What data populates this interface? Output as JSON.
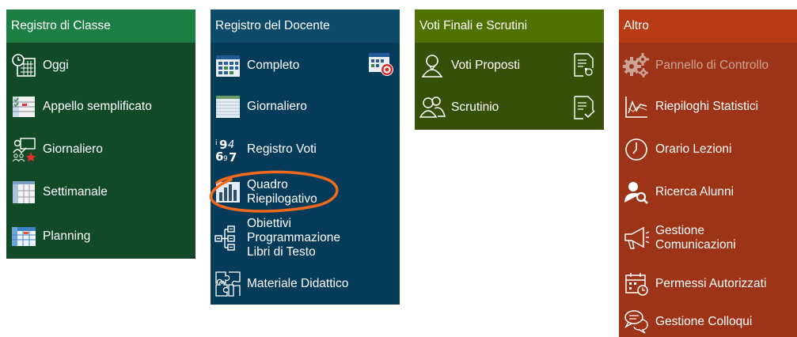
{
  "panels": {
    "registro_classe": {
      "title": "Registro di Classe",
      "items": [
        "Oggi",
        "Appello semplificato",
        "Giornaliero",
        "Settimanale",
        "Planning"
      ]
    },
    "registro_docente": {
      "title": "Registro del Docente",
      "items": [
        "Completo",
        "Giornaliero",
        "Registro Voti",
        "Quadro\nRiepilogativo",
        "Obiettivi\nProgrammazione\nLibri di Testo",
        "Materiale Didattico"
      ]
    },
    "voti_finali": {
      "title": "Voti Finali e Scrutini",
      "items": [
        "Voti Proposti",
        "Scrutinio"
      ]
    },
    "altro": {
      "title": "Altro",
      "items": [
        "Pannello di Controllo",
        "Riepiloghi Statistici",
        "Orario Lezioni",
        "Ricerca Alunni",
        "Gestione\nComunicazioni",
        "Permessi Autorizzati",
        "Gestione Colloqui"
      ]
    }
  },
  "colors": {
    "registro_classe_header": "#1e7f45",
    "registro_classe_body": "#124a27",
    "registro_docente_header": "#0b4a68",
    "registro_docente_body": "#073b5a",
    "voti_finali_header": "#4f7205",
    "voti_finali_body": "#36500a",
    "altro_header": "#b73c14",
    "altro_body": "#9e3417",
    "highlight": "#f26a1b"
  },
  "icons": {
    "registro_classe": [
      "clock-calendar-icon",
      "checklist-icon",
      "teacher-star-icon",
      "week-table-icon",
      "planning-grid-icon"
    ],
    "registro_docente": [
      "grid-calendar-icon",
      "notebook-icon",
      "numbers-icon",
      "bar-chart-icon",
      "tree-list-icon",
      "puzzle-icon"
    ],
    "voti_finali": [
      "person-icon",
      "people-icon"
    ],
    "altro": [
      "gears-icon",
      "line-chart-icon",
      "clock-icon",
      "user-search-icon",
      "megaphone-icon",
      "calendar-check-icon",
      "chat-bubbles-icon"
    ]
  }
}
